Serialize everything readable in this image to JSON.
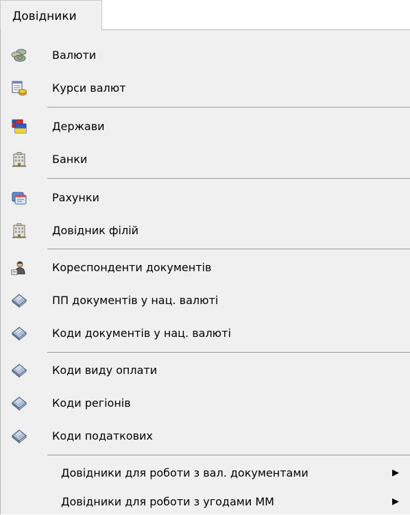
{
  "menubar": {
    "title": "Довідники"
  },
  "menu": {
    "items": [
      {
        "label": "Валюти",
        "icon": "coins-icon"
      },
      {
        "label": "Курси валют",
        "icon": "exchange-rates-icon"
      },
      {
        "label": "Держави",
        "icon": "flags-icon"
      },
      {
        "label": "Банки",
        "icon": "bank-building-icon"
      },
      {
        "label": "Рахунки",
        "icon": "accounts-icon"
      },
      {
        "label": "Довідник філій",
        "icon": "bank-building-icon"
      },
      {
        "label": "Кореспонденти документів",
        "icon": "correspondent-person-icon"
      },
      {
        "label": "ПП документів у нац. валюті",
        "icon": "document-book-icon"
      },
      {
        "label": "Коди документів у нац. валюті",
        "icon": "document-book-icon"
      },
      {
        "label": "Коди виду оплати",
        "icon": "document-book-icon"
      },
      {
        "label": "Коди регіонів",
        "icon": "document-book-icon"
      },
      {
        "label": "Коди податкових",
        "icon": "document-book-icon"
      },
      {
        "label": "Довідники для роботи з вал. документами",
        "icon": "",
        "submenu_arrow": "▶"
      },
      {
        "label": "Довідники для роботи з угодами ММ",
        "icon": "",
        "submenu_arrow": "▶"
      }
    ]
  }
}
